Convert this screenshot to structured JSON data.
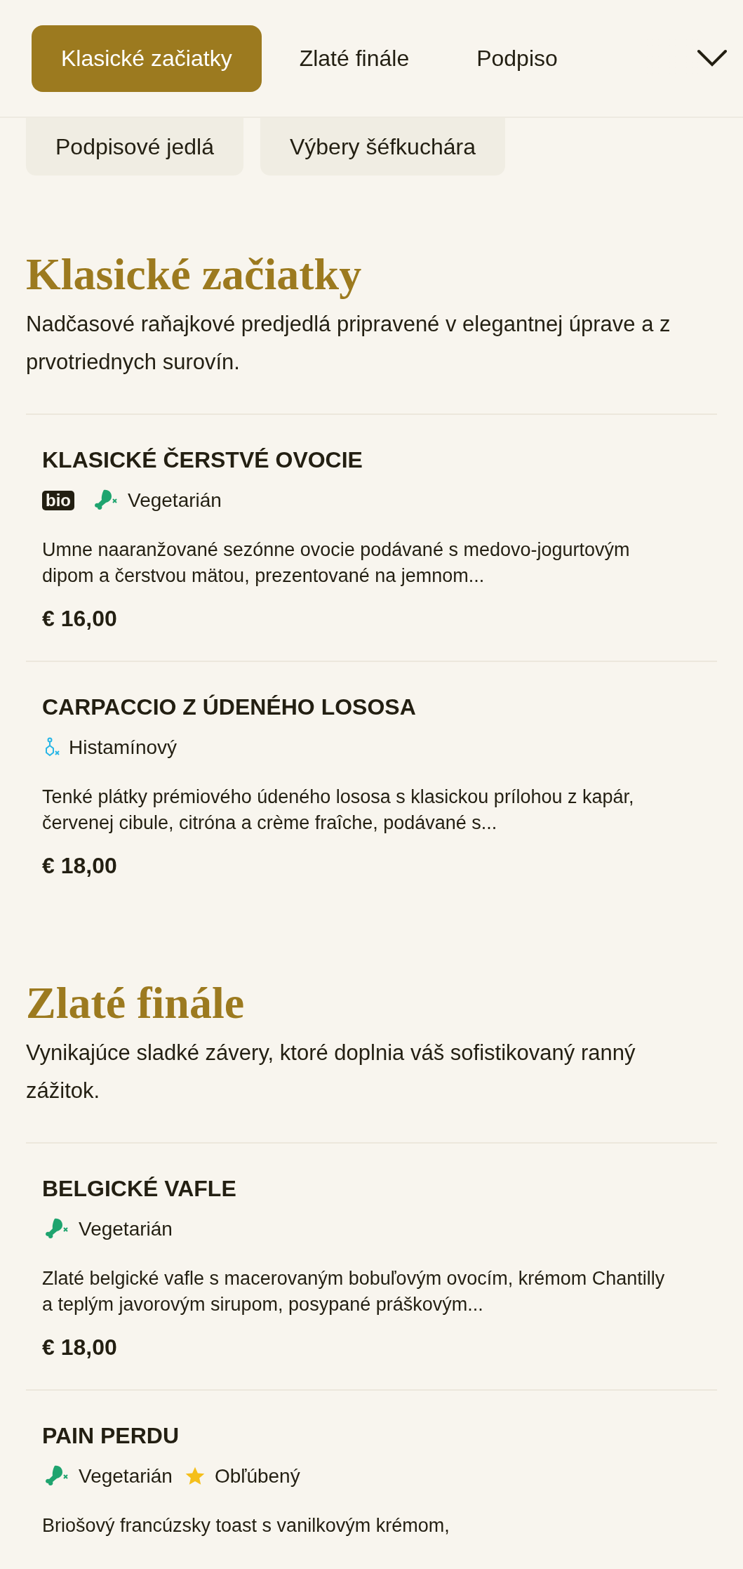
{
  "tabs": [
    {
      "label": "Klasické začiatky",
      "selected": true
    },
    {
      "label": "Zlaté finále",
      "selected": false
    },
    {
      "label": "Podpiso",
      "selected": false
    }
  ],
  "more_categories": [
    {
      "label": "Podpisové jedlá",
      "selected": false
    },
    {
      "label": "Výbery šéfkuchára",
      "selected": false
    }
  ],
  "sections": [
    {
      "title": "Klasické začiatky",
      "description": "Nadčasové raňajkové predjedlá pripravené v elegantnej úprave a z prvotriednych surovín.",
      "items": [
        {
          "name": "KLASICKÉ ČERSTVÉ OVOCIE",
          "tags": [
            {
              "kind": "badge",
              "label": "bio"
            },
            {
              "kind": "vegetarian",
              "label": "Vegetarián"
            }
          ],
          "description": "Umne naaranžované sezónne ovocie podávané s medovo-jogurtovým dipom a čerstvou mätou, prezentované na jemnom...",
          "price": "€ 16,00"
        },
        {
          "name": "CARPACCIO Z ÚDENÉHO LOSOSA",
          "tags": [
            {
              "kind": "histamine",
              "label": "Histamínový"
            }
          ],
          "description": "Tenké plátky prémiového údeného lososa s klasickou prílohou z kapár, červenej cibule, citróna a crème fraîche, podávané s...",
          "price": "€ 18,00"
        }
      ]
    },
    {
      "title": "Zlaté finále",
      "description": "Vynikajúce sladké závery, ktoré doplnia váš sofistikovaný ranný zážitok.",
      "items": [
        {
          "name": "BELGICKÉ VAFLE",
          "tags": [
            {
              "kind": "vegetarian",
              "label": "Vegetarián"
            }
          ],
          "description": "Zlaté belgické vafle s macerovaným bobuľovým ovocím, krémom Chantilly a teplým javorovým sirupom, posypané práškovým...",
          "price": "€ 18,00"
        },
        {
          "name": "PAIN PERDU",
          "tags": [
            {
              "kind": "vegetarian",
              "label": "Vegetarián"
            },
            {
              "kind": "favorite",
              "label": "Obľúbený"
            }
          ],
          "description": "Briošový francúzsky toast s vanilkovým krémom,"
        }
      ]
    }
  ]
}
